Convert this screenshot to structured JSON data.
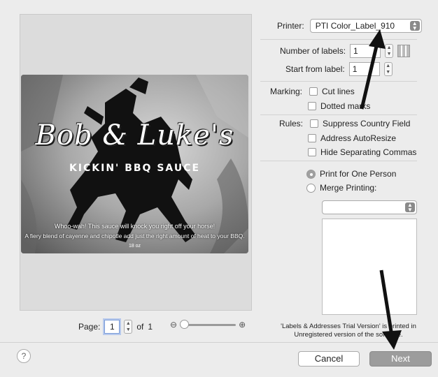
{
  "preview": {
    "label": {
      "brand": "Bob & Luke's",
      "tagline": "KICKIN' BBQ SAUCE",
      "blurb_line1": "Whoo-wah! This sauce will knock you right off your horse!",
      "blurb_line2": "A fiery blend of cayenne and chipotle add just the right amount of heat to your BBQ.",
      "weight": "18 oz"
    },
    "page_label": "Page:",
    "page_value": "1",
    "page_of": "of",
    "page_total": "1"
  },
  "printer": {
    "label": "Printer:",
    "value": "PTI Color_Label_910"
  },
  "labels": {
    "number_label": "Number of labels:",
    "number_value": "1",
    "start_label": "Start from label:",
    "start_value": "1"
  },
  "marking": {
    "label": "Marking:",
    "cut_lines": "Cut lines",
    "dotted_marks": "Dotted marks"
  },
  "rules": {
    "label": "Rules:",
    "suppress_country": "Suppress Country Field",
    "address_autoresize": "Address AutoResize",
    "hide_commas": "Hide Separating Commas"
  },
  "print_mode": {
    "one_person": "Print for One Person",
    "merge": "Merge Printing:",
    "merge_select_value": ""
  },
  "note": {
    "line1": "'Labels & Addresses Trial Version' is printed in",
    "line2": "Unregistered version of the software."
  },
  "footer": {
    "help": "?",
    "cancel": "Cancel",
    "next": "Next"
  },
  "colors": {
    "arrow": "#111111",
    "next_button": "#9c9c9c"
  }
}
